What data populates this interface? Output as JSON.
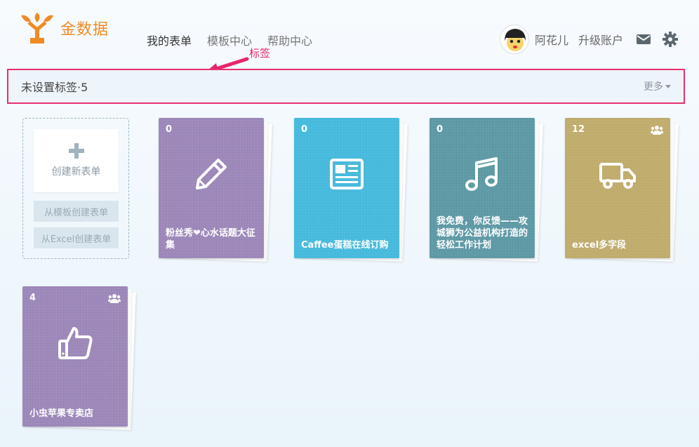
{
  "app": {
    "name": "金数据"
  },
  "nav": [
    {
      "label": "我的表单",
      "active": true
    },
    {
      "label": "模板中心",
      "active": false
    },
    {
      "label": "帮助中心",
      "active": false
    }
  ],
  "user": {
    "name": "阿花儿",
    "upgrade_label": "升级账户"
  },
  "annotation": {
    "label": "标签"
  },
  "tagbar": {
    "title": "未设置标签·5",
    "more_label": "更多"
  },
  "create": {
    "new_label": "创建新表单",
    "from_template_label": "从模板创建表单",
    "from_excel_label": "从Excel创建表单"
  },
  "forms": [
    {
      "count": "0",
      "title": "粉丝秀❤心水话题大征集",
      "icon": "pencil-icon",
      "color": "#9b86b8",
      "shared": false
    },
    {
      "count": "0",
      "title": "Caffee蛋糕在线订购",
      "icon": "newspaper-icon",
      "color": "#45b9dc",
      "shared": false
    },
    {
      "count": "0",
      "title": "我免费，你反馈——攻城狮为公益机构打造的轻松工作计划",
      "icon": "music-icon",
      "color": "#5c98a4",
      "shared": false
    },
    {
      "count": "12",
      "title": "excel多字段",
      "icon": "truck-icon",
      "color": "#bfab6b",
      "shared": true
    },
    {
      "count": "4",
      "title": "小虫苹果专卖店",
      "icon": "thumbs-up-icon",
      "color": "#9b86b8",
      "shared": true
    }
  ],
  "colors": {
    "accent": "#f08a24",
    "highlight": "#e8306f"
  }
}
